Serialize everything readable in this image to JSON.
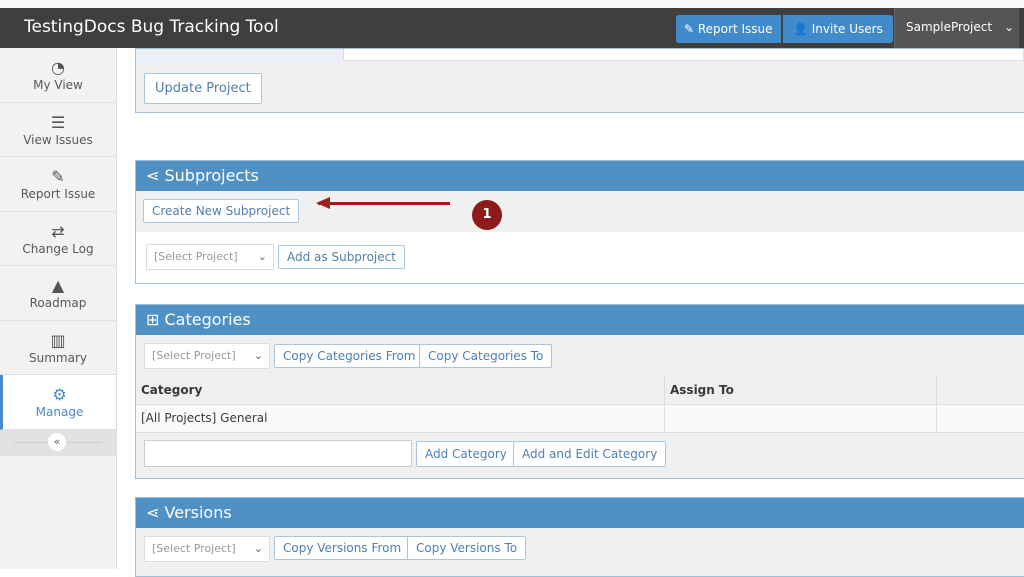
{
  "app": {
    "title": "TestingDocs Bug Tracking Tool",
    "report_issue": "Report Issue",
    "invite_users": "Invite Users",
    "project": "SampleProject"
  },
  "sidebar": {
    "items": [
      {
        "label": "My View",
        "icon": "dashboard-icon"
      },
      {
        "label": "View Issues",
        "icon": "list-icon"
      },
      {
        "label": "Report Issue",
        "icon": "edit-icon"
      },
      {
        "label": "Change Log",
        "icon": "retweet-icon"
      },
      {
        "label": "Roadmap",
        "icon": "road-icon"
      },
      {
        "label": "Summary",
        "icon": "bar-chart-icon"
      },
      {
        "label": "Manage",
        "icon": "gears-icon",
        "active": true
      }
    ],
    "collapse": "«"
  },
  "project_section": {
    "update_button": "Update Project"
  },
  "subprojects": {
    "title": "Subprojects",
    "create_button": "Create New Subproject",
    "select": "[Select Project]",
    "add_button": "Add as Subproject"
  },
  "annotation": {
    "number": "1",
    "color": "#8e1b1b"
  },
  "categories": {
    "title": "Categories",
    "select": "[Select Project]",
    "copy_from": "Copy Categories From",
    "copy_to": "Copy Categories To",
    "columns": [
      "Category",
      "Assign To"
    ],
    "rows": [
      [
        "[All Projects] General",
        ""
      ]
    ],
    "add_button": "Add Category",
    "add_edit_button": "Add and Edit Category"
  },
  "versions": {
    "title": "Versions",
    "select": "[Select Project]",
    "copy_from": "Copy Versions From",
    "copy_to": "Copy Versions To"
  },
  "colors": {
    "navbar": "#3f3f3f",
    "accent": "#428bca",
    "section_header": "#4f90c5"
  }
}
